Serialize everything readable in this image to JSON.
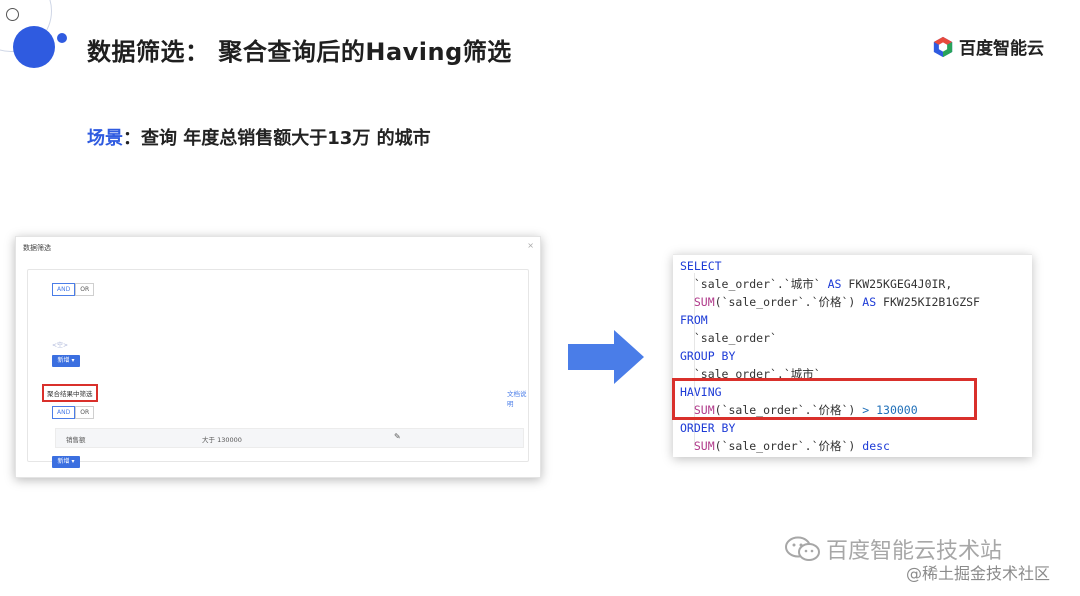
{
  "slide": {
    "title": "数据筛选：  聚合查询后的Having筛选",
    "brand_name": "百度智能云",
    "scenario_label": "场景",
    "scenario_text": "：查询 年度总销售额大于13万 的城市"
  },
  "dialog": {
    "title": "数据筛选",
    "close_icon": "×",
    "top_group": {
      "logic_options": [
        "AND",
        "OR"
      ],
      "active": "AND",
      "empty_hint": "<空>",
      "add_label": "新增"
    },
    "aggregate_section": {
      "label": "聚合结果中筛选",
      "doc_link": "文档说明",
      "logic_options": [
        "AND",
        "OR"
      ],
      "active": "AND",
      "condition": {
        "field": "销售额",
        "operator": "大于 130000"
      },
      "add_label": "新增"
    }
  },
  "sql": {
    "lines": [
      [
        {
          "t": "SELECT",
          "c": "kw"
        }
      ],
      [
        {
          "t": "  `sale_order`.`城市` ",
          "c": ""
        },
        {
          "t": "AS",
          "c": "kw"
        },
        {
          "t": " FKW25KGEG4J0IR,",
          "c": ""
        }
      ],
      [
        {
          "t": "  ",
          "c": ""
        },
        {
          "t": "SUM",
          "c": "fn"
        },
        {
          "t": "(`sale_order`.`价格`) ",
          "c": ""
        },
        {
          "t": "AS",
          "c": "kw"
        },
        {
          "t": " FKW25KI2B1GZSF",
          "c": ""
        }
      ],
      [
        {
          "t": "FROM",
          "c": "kw"
        }
      ],
      [
        {
          "t": "  `sale_order`",
          "c": ""
        }
      ],
      [
        {
          "t": "GROUP BY",
          "c": "kw"
        }
      ],
      [
        {
          "t": "  `sale_order`.`城市`",
          "c": ""
        }
      ],
      [
        {
          "t": "HAVING",
          "c": "kw"
        }
      ],
      [
        {
          "t": "  ",
          "c": ""
        },
        {
          "t": "SUM",
          "c": "fn"
        },
        {
          "t": "(`sale_order`.`价格`) ",
          "c": ""
        },
        {
          "t": "> 130000",
          "c": "num"
        }
      ],
      [
        {
          "t": "ORDER BY",
          "c": "kw"
        }
      ],
      [
        {
          "t": "  ",
          "c": ""
        },
        {
          "t": "SUM",
          "c": "fn"
        },
        {
          "t": "(`sale_order`.`价格`) ",
          "c": ""
        },
        {
          "t": "desc",
          "c": "kw"
        }
      ]
    ]
  },
  "watermark": {
    "line1": "百度智能云技术站",
    "line2": "@稀土掘金技术社区"
  },
  "colors": {
    "accent": "#2f5be0",
    "highlight": "#d9302b",
    "keyword": "#1d3bd6"
  }
}
